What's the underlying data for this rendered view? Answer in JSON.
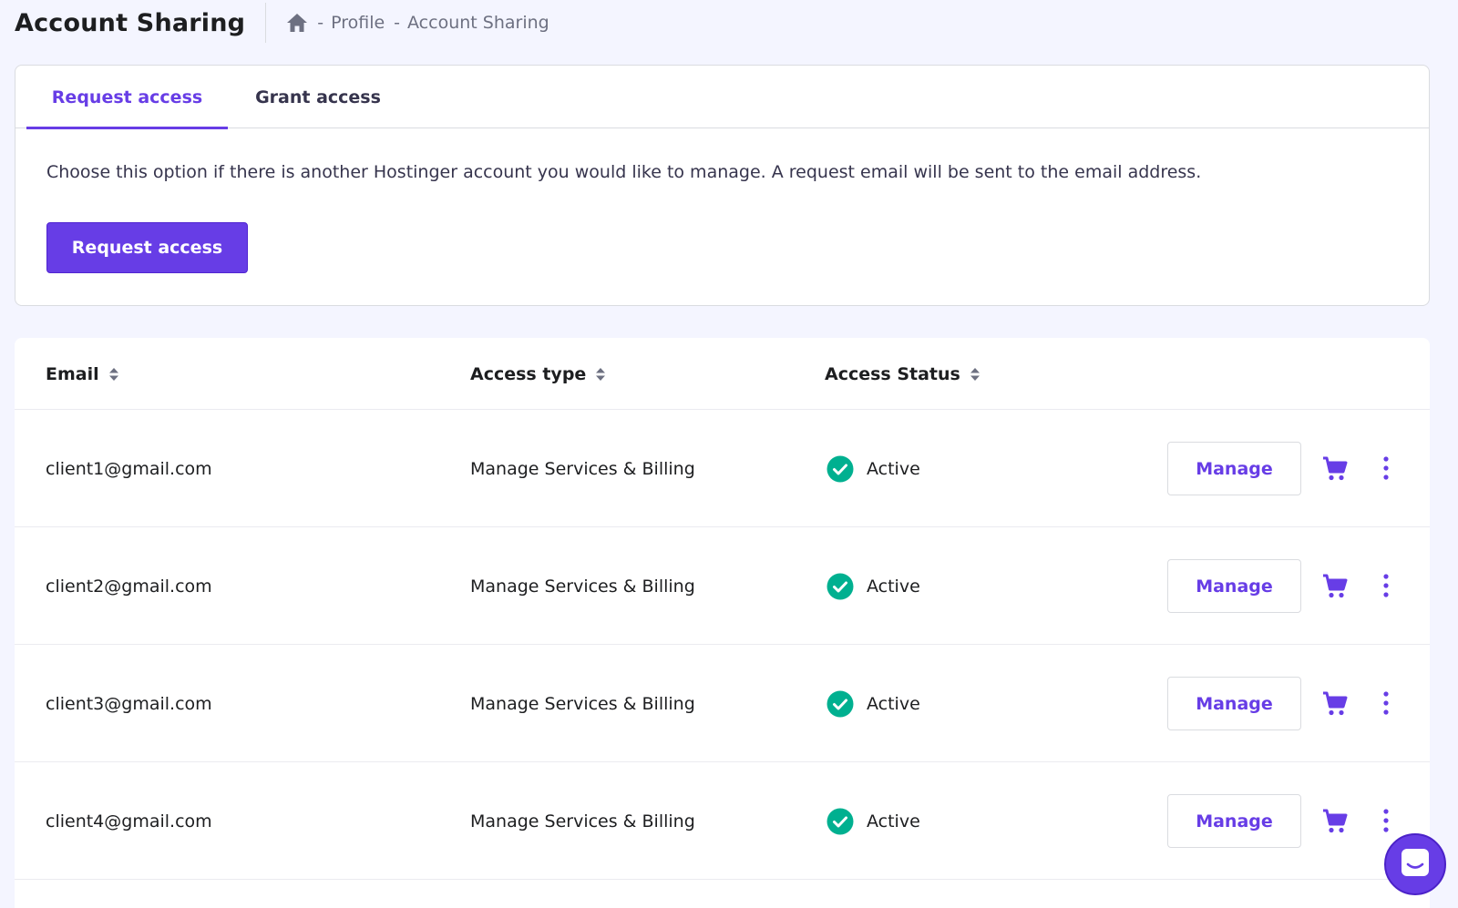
{
  "header": {
    "title": "Account Sharing",
    "breadcrumb": {
      "home_icon": "home-icon",
      "separator": "-",
      "items": [
        "Profile",
        "Account Sharing"
      ]
    }
  },
  "tabs": {
    "items": [
      {
        "label": "Request access",
        "active": true
      },
      {
        "label": "Grant access",
        "active": false
      }
    ],
    "description": "Choose this option if there is another Hostinger account you would like to manage. A request email will be sent to the email address.",
    "button_label": "Request access"
  },
  "table": {
    "columns": [
      {
        "label": "Email",
        "sort_icon": "sort-icon"
      },
      {
        "label": "Access type",
        "sort_icon": "sort-icon"
      },
      {
        "label": "Access Status",
        "sort_icon": "sort-icon"
      }
    ],
    "rows": [
      {
        "email": "client1@gmail.com",
        "access_type": "Manage Services & Billing",
        "status": "Active",
        "manage_label": "Manage"
      },
      {
        "email": "client2@gmail.com",
        "access_type": "Manage Services & Billing",
        "status": "Active",
        "manage_label": "Manage"
      },
      {
        "email": "client3@gmail.com",
        "access_type": "Manage Services & Billing",
        "status": "Active",
        "manage_label": "Manage"
      },
      {
        "email": "client4@gmail.com",
        "access_type": "Manage Services & Billing",
        "status": "Active",
        "manage_label": "Manage"
      }
    ]
  },
  "colors": {
    "accent": "#673de6",
    "status_active": "#00b090",
    "background": "#f4f5ff"
  },
  "chat": {
    "icon": "chat-icon"
  }
}
